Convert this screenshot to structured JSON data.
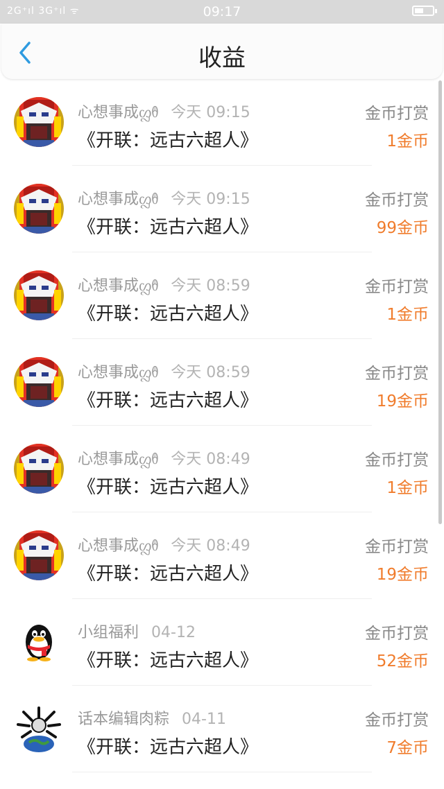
{
  "status_bar": {
    "signal_text": "2G⁺ıl 3G⁺ıl ᯤ",
    "time": "09:17",
    "icons": [
      "signal-icon",
      "wifi-icon",
      "battery-icon"
    ]
  },
  "header": {
    "title": "收益",
    "back_icon": "chevron-left-icon"
  },
  "colors": {
    "amount": "#f07c2c",
    "back": "#2f9be0",
    "title": "#222222",
    "status_bar_bg": "#d9d9d9"
  },
  "rows": [
    {
      "name": "心想事成ᦜᦹ",
      "time": "今天 09:15",
      "book": "《开联：远古六超人》",
      "type": "金币打赏",
      "amount": "1金币",
      "avatar": "robot"
    },
    {
      "name": "心想事成ᦜᦹ",
      "time": "今天 09:15",
      "book": "《开联：远古六超人》",
      "type": "金币打赏",
      "amount": "99金币",
      "avatar": "robot"
    },
    {
      "name": "心想事成ᦜᦹ",
      "time": "今天 08:59",
      "book": "《开联：远古六超人》",
      "type": "金币打赏",
      "amount": "1金币",
      "avatar": "robot"
    },
    {
      "name": "心想事成ᦜᦹ",
      "time": "今天 08:59",
      "book": "《开联：远古六超人》",
      "type": "金币打赏",
      "amount": "19金币",
      "avatar": "robot"
    },
    {
      "name": "心想事成ᦜᦹ",
      "time": "今天 08:49",
      "book": "《开联：远古六超人》",
      "type": "金币打赏",
      "amount": "1金币",
      "avatar": "robot"
    },
    {
      "name": "心想事成ᦜᦹ",
      "time": "今天 08:49",
      "book": "《开联：远古六超人》",
      "type": "金币打赏",
      "amount": "19金币",
      "avatar": "robot"
    },
    {
      "name": "小组福利",
      "time": "04-12",
      "book": "《开联：远古六超人》",
      "type": "金币打赏",
      "amount": "52金币",
      "avatar": "penguin"
    },
    {
      "name": "话本编辑肉粽",
      "time": "04-11",
      "book": "《开联：远古六超人》",
      "type": "金币打赏",
      "amount": "7金币",
      "avatar": "globe"
    }
  ]
}
